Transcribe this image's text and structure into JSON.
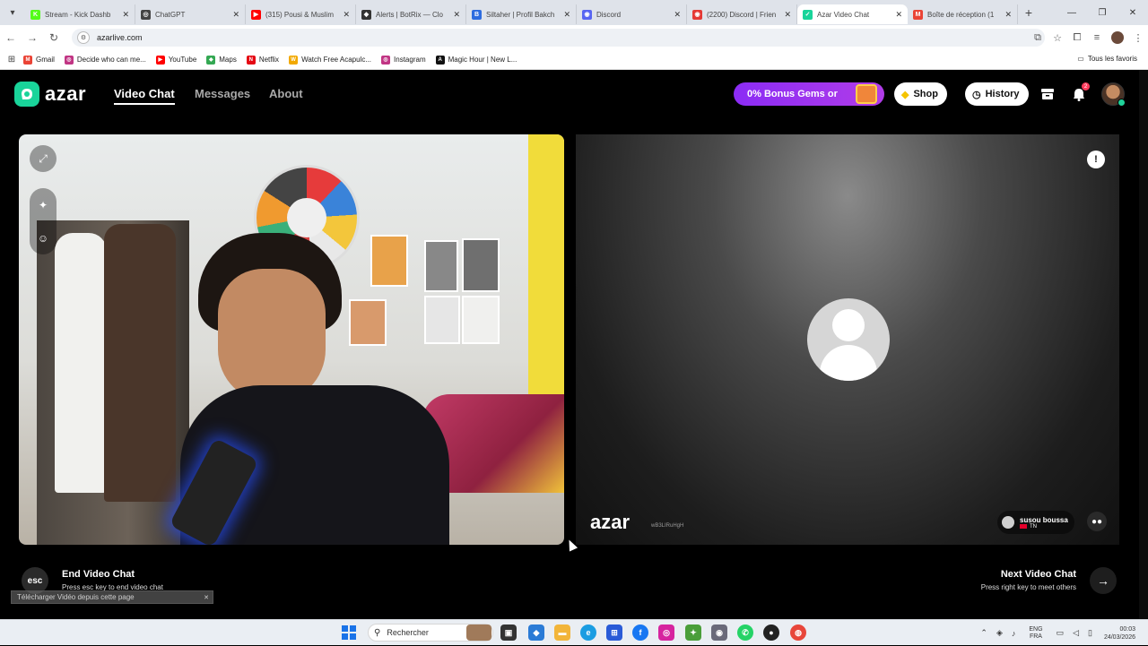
{
  "browser": {
    "tabs": [
      {
        "title": "Stream - Kick Dashb",
        "color": "#53fc18",
        "glyph": "K"
      },
      {
        "title": "ChatGPT",
        "color": "#444444",
        "glyph": "◎"
      },
      {
        "title": "(315) Pousi & Muslim",
        "color": "#ff0000",
        "glyph": "▶"
      },
      {
        "title": "Alerts | BotRix — Clo",
        "color": "#333333",
        "glyph": "◆"
      },
      {
        "title": "Siltaher | Profil Bakch",
        "color": "#2d6cdf",
        "glyph": "B"
      },
      {
        "title": "Discord",
        "color": "#5865f2",
        "glyph": "◉"
      },
      {
        "title": "(2200) Discord | Frien",
        "color": "#e53935",
        "glyph": "◉"
      },
      {
        "title": "Azar Video Chat",
        "color": "#19d49a",
        "glyph": "✓"
      },
      {
        "title": "Boîte de réception (1",
        "color": "#ea4335",
        "glyph": "M"
      }
    ],
    "url": "azarlive.com",
    "bookmarks": [
      {
        "label": "Gmail",
        "color": "#ea4335",
        "glyph": "M"
      },
      {
        "label": "Decide who can me...",
        "color": "#c13584",
        "glyph": "◎"
      },
      {
        "label": "YouTube",
        "color": "#ff0000",
        "glyph": "▶"
      },
      {
        "label": "Maps",
        "color": "#34a853",
        "glyph": "◆"
      },
      {
        "label": "Netflix",
        "color": "#e50914",
        "glyph": "N"
      },
      {
        "label": "Watch Free Acapulc...",
        "color": "#f2a900",
        "glyph": "W"
      },
      {
        "label": "Instagram",
        "color": "#c13584",
        "glyph": "◎"
      },
      {
        "label": "Magic Hour | New L...",
        "color": "#111111",
        "glyph": "A"
      }
    ],
    "bookmarks_right": "Tous les favoris"
  },
  "azar": {
    "logo": "azar",
    "nav": {
      "video_chat": "Video Chat",
      "messages": "Messages",
      "about": "About"
    },
    "promo": "0% Bonus Gems or",
    "shop": "Shop",
    "history": "History",
    "notification_count": "2",
    "remote": {
      "logo": "azar",
      "id": "wB3LIRuHgH",
      "peer_name": "susou boussa",
      "peer_country": "TN"
    },
    "controls": {
      "esc_key": "esc",
      "end_title": "End Video Chat",
      "end_sub": "Press esc key to end video chat",
      "next_title": "Next Video Chat",
      "next_sub": "Press right key to meet others"
    },
    "download_bar": "Télécharger Vidéo depuis cette page"
  },
  "taskbar": {
    "search_placeholder": "Rechercher",
    "lang_1": "ENG",
    "lang_2": "FRA",
    "time": "00:03",
    "date": "24/03/2026"
  },
  "colors": {
    "brand": "#19d49a",
    "promo_start": "#8b2cf5",
    "promo_end": "#b13ce8"
  }
}
